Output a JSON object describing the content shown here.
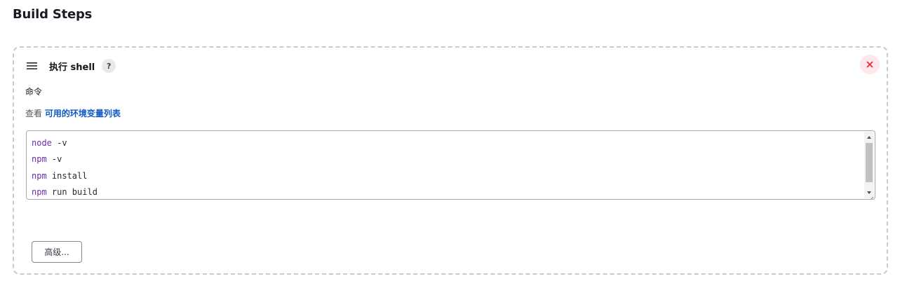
{
  "section": {
    "title": "Build Steps"
  },
  "step": {
    "title": "执行 shell",
    "help_label": "?",
    "field_label": "命令",
    "env_prefix": "查看",
    "env_link": "可用的环境变量列表",
    "command_lines": [
      {
        "cmd": "node",
        "args": " -v"
      },
      {
        "cmd": "npm",
        "args": " -v"
      },
      {
        "cmd": "npm",
        "args": " install"
      },
      {
        "cmd": "npm",
        "args": " run build"
      }
    ],
    "advanced_label": "高级..."
  },
  "icons": {
    "drag": "hamburger-icon",
    "help": "question-icon",
    "delete": "close-icon"
  },
  "colors": {
    "accent_link": "#1059c7",
    "delete_bg": "#fde7ea",
    "delete_fg": "#e0243f",
    "keyword": "#6e2fa8"
  }
}
